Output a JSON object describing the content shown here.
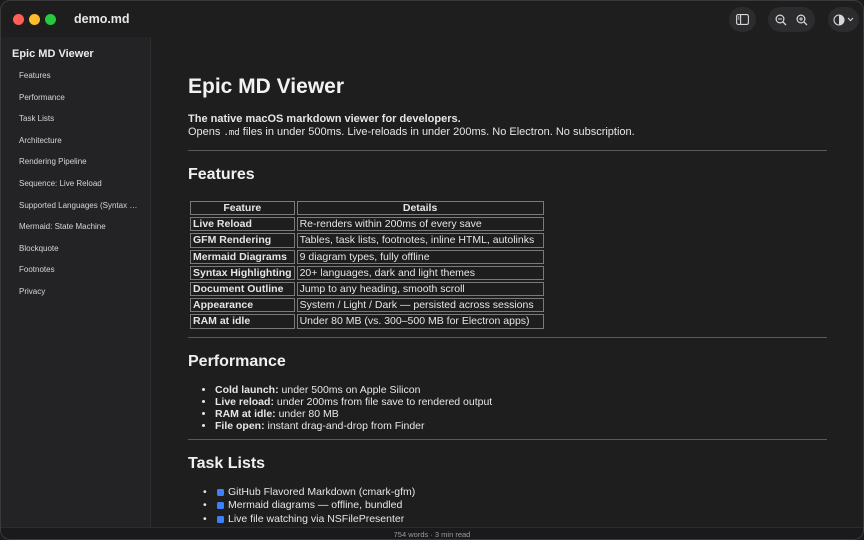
{
  "window": {
    "title": "demo.md"
  },
  "toolbar": {
    "sidebar_icon": "sidebar-toggle-icon",
    "zoom_out_icon": "zoom-out-icon",
    "zoom_in_icon": "zoom-in-icon",
    "theme_icon": "contrast-icon"
  },
  "sidebar": {
    "title": "Epic MD Viewer",
    "items": [
      "Features",
      "Performance",
      "Task Lists",
      "Architecture",
      "Rendering Pipeline",
      "Sequence: Live Reload",
      "Supported Languages (Syntax Highlighting)",
      "Mermaid: State Machine",
      "Blockquote",
      "Footnotes",
      "Privacy"
    ]
  },
  "doc": {
    "title": "Epic MD Viewer",
    "tagline": "The native macOS markdown viewer for developers.",
    "intro_before": "Opens ",
    "intro_code": ".md",
    "intro_after": " files in under 500ms. Live-reloads in under 200ms. No Electron. No subscription.",
    "features_heading": "Features",
    "table": {
      "headers": [
        "Feature",
        "Details"
      ],
      "rows": [
        [
          "Live Reload",
          "Re-renders within 200ms of every save"
        ],
        [
          "GFM Rendering",
          "Tables, task lists, footnotes, inline HTML, autolinks"
        ],
        [
          "Mermaid Diagrams",
          "9 diagram types, fully offline"
        ],
        [
          "Syntax Highlighting",
          "20+ languages, dark and light themes"
        ],
        [
          "Document Outline",
          "Jump to any heading, smooth scroll"
        ],
        [
          "Appearance",
          "System / Light / Dark — persisted across sessions"
        ],
        [
          "RAM at idle",
          "Under 80 MB (vs. 300–500 MB for Electron apps)"
        ]
      ]
    },
    "performance_heading": "Performance",
    "performance": [
      {
        "label": "Cold launch:",
        "text": " under 500ms on Apple Silicon"
      },
      {
        "label": "Live reload:",
        "text": " under 200ms from file save to rendered output"
      },
      {
        "label": "RAM at idle:",
        "text": " under 80 MB"
      },
      {
        "label": "File open:",
        "text": " instant drag-and-drop from Finder"
      }
    ],
    "tasks_heading": "Task Lists",
    "tasks": [
      {
        "text": "GitHub Flavored Markdown (cmark-gfm)",
        "checked": true
      },
      {
        "text": "Mermaid diagrams — offline, bundled",
        "checked": true
      },
      {
        "text": "Live file watching via NSFilePresenter",
        "checked": true
      }
    ]
  },
  "status": {
    "text": "754 words · 3 min read"
  },
  "colors": {
    "accent": "#3b82f6",
    "background": "#1e1e1e",
    "sidebar": "#232325"
  }
}
